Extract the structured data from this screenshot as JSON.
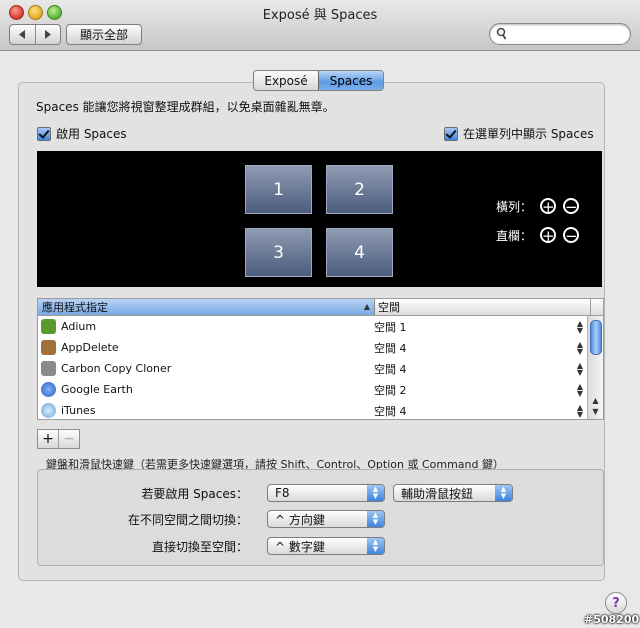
{
  "window": {
    "title": "Exposé 與 Spaces"
  },
  "toolbar": {
    "back_icon": "chevron-left-icon",
    "forward_icon": "chevron-right-icon",
    "show_all_label": "顯示全部",
    "search_value": "",
    "search_icon": "magnifier-icon"
  },
  "tabs": [
    {
      "label": "Exposé",
      "selected": false
    },
    {
      "label": "Spaces",
      "selected": true
    }
  ],
  "spaces": {
    "description": "Spaces 能讓您將視窗整理成群組，以免桌面雜亂無章。",
    "enable_label": "啟用 Spaces",
    "enable_checked": true,
    "menubar_label": "在選單列中顯示 Spaces",
    "menubar_checked": true,
    "grid": [
      "1",
      "2",
      "3",
      "4"
    ],
    "rows_label": "橫列：",
    "cols_label": "直欄：",
    "add_symbol": "+",
    "remove_symbol": "−"
  },
  "bindings_table": {
    "columns": [
      "應用程式指定",
      "空間"
    ],
    "rows": [
      {
        "app": "Adium",
        "space": "空間 1",
        "icon": "adium-icon",
        "color": "#5a9a2c"
      },
      {
        "app": "AppDelete",
        "space": "空間 4",
        "icon": "appdelete-icon",
        "color": "#a0703a"
      },
      {
        "app": "Carbon Copy Cloner",
        "space": "空間 4",
        "icon": "carbon-copy-cloner-icon",
        "color": "#8a8a8a"
      },
      {
        "app": "Google Earth",
        "space": "空間 2",
        "icon": "google-earth-icon",
        "color": "#2f5fb8"
      },
      {
        "app": "iTunes",
        "space": "空間 4",
        "icon": "itunes-icon",
        "color": "#6a9fd8"
      }
    ],
    "add_label": "+",
    "remove_label": "−"
  },
  "shortcuts": {
    "legend": "鍵盤和滑鼠快速鍵（若需更多快速鍵選項，請按 Shift、Control、Option 或 Command 鍵）",
    "activate_label": "若要啟用 Spaces：",
    "activate_value": "F8",
    "activate_mouse_value": "輔助滑鼠按鈕",
    "switch_label": "在不同空間之間切換：",
    "switch_value": "^ 方向鍵",
    "direct_label": "直接切換至空間：",
    "direct_value": "^ 數字鍵"
  },
  "help_label": "?",
  "watermark": "#508200"
}
